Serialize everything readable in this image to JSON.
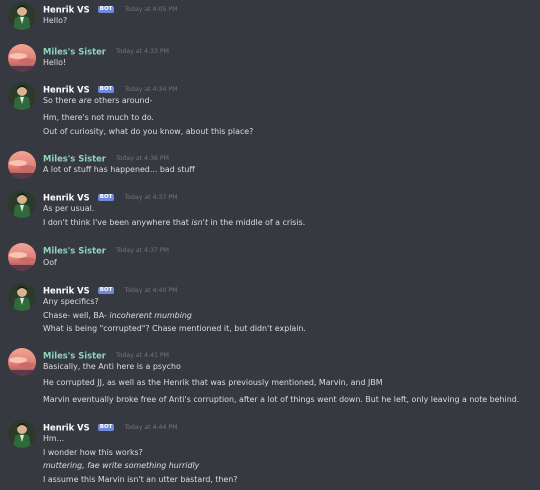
{
  "messages": [
    {
      "author": "Henrik VS",
      "bot": true,
      "badge": "BOT",
      "timestamp": "Today at 4:05 PM",
      "lines": [
        [
          "Hello?"
        ]
      ]
    },
    {
      "author": "Miles's Sister",
      "bot": false,
      "timestamp": "Today at 4:33 PM",
      "lines": [
        [
          "Hello!"
        ]
      ]
    },
    {
      "author": "Henrik VS",
      "bot": true,
      "badge": "BOT",
      "timestamp": "Today at 4:34 PM",
      "lines": [
        [
          "So there ",
          "are",
          " others around-"
        ],
        [
          "Hm, there's not much to do."
        ],
        [
          "Out of curiosity, what do you know, about this place?"
        ]
      ]
    },
    {
      "author": "Miles's Sister",
      "bot": false,
      "timestamp": "Today at 4:36 PM",
      "lines": [
        [
          "A lot of stuff has happened... bad stuff"
        ]
      ]
    },
    {
      "author": "Henrik VS",
      "bot": true,
      "badge": "BOT",
      "timestamp": "Today at 4:37 PM",
      "lines": [
        [
          "As per usual."
        ],
        [
          "I don't think I've been anywhere that ",
          "isn't",
          " in the middle of a crisis."
        ]
      ]
    },
    {
      "author": "Miles's Sister",
      "bot": false,
      "timestamp": "Today at 4:37 PM",
      "lines": [
        [
          "Oof"
        ]
      ]
    },
    {
      "author": "Henrik VS",
      "bot": true,
      "badge": "BOT",
      "timestamp": "Today at 4:40 PM",
      "lines": [
        [
          "Any specifics?"
        ],
        [
          "Chase- well, BA- ",
          "incoherent mumbing",
          ""
        ],
        [
          "What is being \"corrupted\"? Chase mentioned it, but didn't explain."
        ]
      ]
    },
    {
      "author": "Miles's Sister",
      "bot": false,
      "timestamp": "Today at 4:41 PM",
      "lines": [
        [
          "Basically, the Anti here is a psycho"
        ],
        [
          "He corrupted JJ, as well as the Henrik that was previously mentioned, Marvin, and JBM"
        ],
        [
          "Marvin eventually broke free of Anti's corruption, after a lot of things went down. But he left, only leaving a note behind."
        ]
      ]
    },
    {
      "author": "Henrik VS",
      "bot": true,
      "badge": "BOT",
      "timestamp": "Today at 4:44 PM",
      "lines": [
        [
          "Hm..."
        ],
        [
          "I wonder how this works?"
        ],
        [
          "",
          "muttering, fae write something hurridly",
          ""
        ],
        [
          "I assume this Marvin isn't an utter bastard, then?"
        ]
      ]
    }
  ],
  "colors": {
    "background": "#36393f",
    "text": "#dcddde",
    "timestamp": "#72767d",
    "bot_badge": "#7289da",
    "sister_name": "#8fd6bd"
  },
  "avatars": {
    "henrik": "green-suit-figure-avatar",
    "sister": "sunset-sky-avatar"
  }
}
